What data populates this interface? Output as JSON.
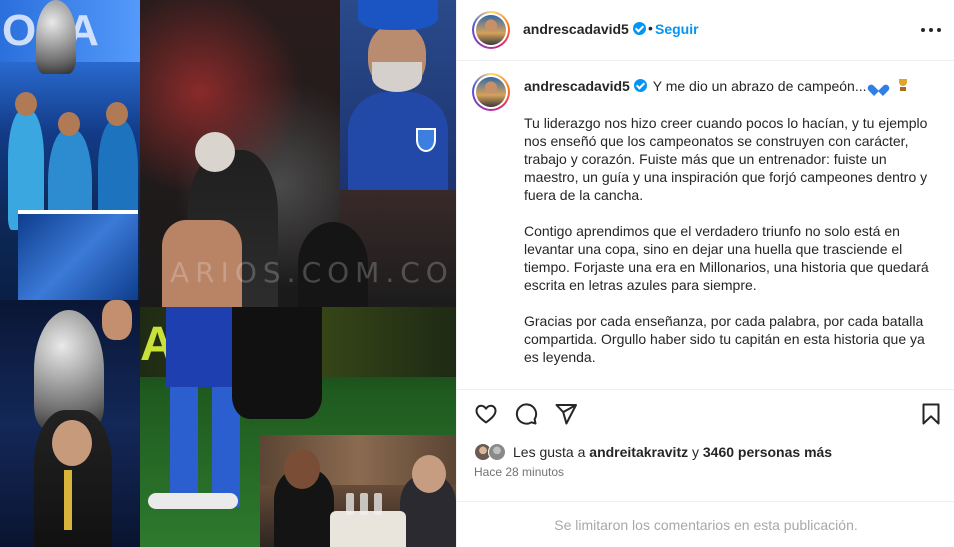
{
  "post_image": {
    "banner_text": "OLA",
    "stadium_sign": "ATIZA",
    "watermark": "NARIOS.CO",
    "watermark_center": "ARIOS.COM.CO"
  },
  "header": {
    "username": "andrescadavid5",
    "separator": "•",
    "follow_label": "Seguir",
    "more_icon": "more-horizontal-icon"
  },
  "caption": {
    "username": "andrescadavid5",
    "first_line": "Y me dio un abrazo de campeón...",
    "emojis": [
      "blue-heart",
      "trophy"
    ],
    "paragraphs": [
      [
        "Tu liderazgo nos hizo creer cuando pocos lo hacían, y tu ejemplo",
        "nos enseñó que los campeonatos se construyen con carácter,",
        "trabajo y corazón. Fuiste más que un entrenador: fuiste un",
        "maestro, un guía y una inspiración que forjó campeones dentro y",
        "fuera de la cancha."
      ],
      [
        "Contigo aprendimos que el verdadero triunfo no solo está en",
        "levantar una copa, sino en dejar una huella que trasciende el",
        "tiempo. Forjaste una era en Millonarios, una historia que quedará",
        "escrita en letras azules para siempre."
      ],
      [
        "Gracias por cada enseñanza, por cada palabra, por cada batalla",
        "compartida. Orgullo haber sido tu capitán en esta historia que ya",
        "es leyenda."
      ]
    ]
  },
  "actions": {
    "icons": [
      "heart-icon",
      "comment-icon",
      "share-icon",
      "bookmark-icon"
    ]
  },
  "likes": {
    "prefix": "Les gusta a",
    "liker": "andreitakravitz",
    "connector": "y",
    "others": "3460 personas más",
    "timestamp": "Hace 28 minutos"
  },
  "footer": {
    "comments_limited": "Se limitaron los comentarios en esta publicación."
  },
  "colors": {
    "link_blue": "#0095f6",
    "text": "#262626",
    "muted": "#737373",
    "footer_text": "#a8a8a8",
    "divider": "#efefef"
  }
}
